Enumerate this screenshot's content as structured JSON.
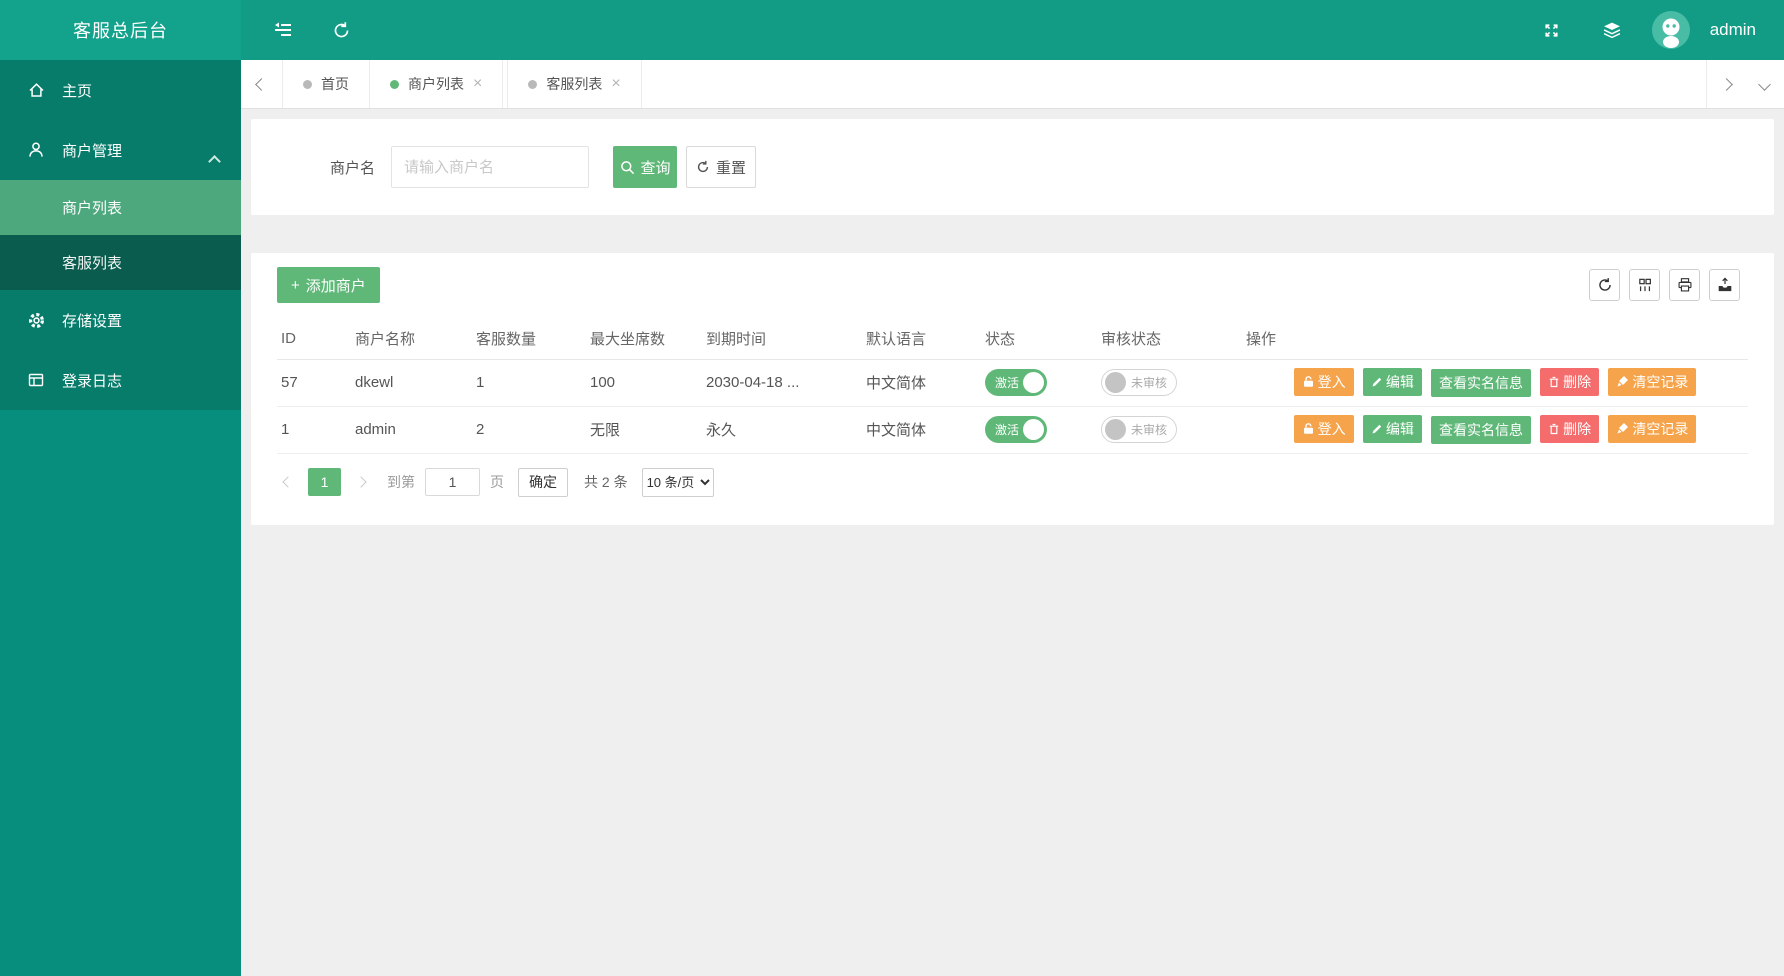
{
  "app": {
    "title": "客服总后台",
    "username": "admin"
  },
  "colors": {
    "accent_green": "#5FB878",
    "accent_orange": "#F6A44C",
    "accent_red": "#F56C6C",
    "navbar_teal": "#129C86",
    "menu_teal": "#077C6B",
    "sidebar_teal": "#088E7C",
    "submenu_active_green": "#4DA87E",
    "submenu_dark": "#095C4E"
  },
  "glyphs": {
    "plus": "+",
    "close": "×"
  },
  "sidebar": {
    "items": [
      {
        "label": "主页",
        "icon": "home-icon"
      },
      {
        "label": "商户管理",
        "icon": "user-icon",
        "expanded": true
      },
      {
        "label": "存储设置",
        "icon": "gear-icon"
      },
      {
        "label": "登录日志",
        "icon": "log-icon"
      }
    ],
    "submenu": [
      {
        "label": "商户列表",
        "active": true
      },
      {
        "label": "客服列表",
        "active": false
      }
    ]
  },
  "tabs": [
    {
      "label": "首页",
      "closable": false,
      "active": false
    },
    {
      "label": "商户列表",
      "closable": true,
      "active": true
    },
    {
      "label": "客服列表",
      "closable": true,
      "active": false
    }
  ],
  "search": {
    "label": "商户名",
    "placeholder": "请输入商户名",
    "query": "查询",
    "reset": "重置"
  },
  "toolbar": {
    "add_label": "添加商户"
  },
  "table": {
    "columns": [
      "ID",
      "商户名称",
      "客服数量",
      "最大坐席数",
      "到期时间",
      "默认语言",
      "状态",
      "审核状态",
      "操作"
    ],
    "rows": [
      {
        "id": "57",
        "name": "dkewl",
        "agents": "1",
        "seats": "100",
        "expire": "2030-04-18 ...",
        "lang": "中文简体",
        "status": "激活",
        "audit": "未审核"
      },
      {
        "id": "1",
        "name": "admin",
        "agents": "2",
        "seats": "无限",
        "expire": "永久",
        "lang": "中文简体",
        "status": "激活",
        "audit": "未审核"
      }
    ],
    "actions": {
      "login": "登入",
      "edit": "编辑",
      "view_realname": "查看实名信息",
      "delete": "删除",
      "clear": "清空记录"
    }
  },
  "pagination": {
    "current": "1",
    "goto_label": "到第",
    "page_value": "1",
    "unit_label": "页",
    "confirm_label": "确定",
    "total_label": "共 2 条",
    "per_page": "10 条/页"
  }
}
